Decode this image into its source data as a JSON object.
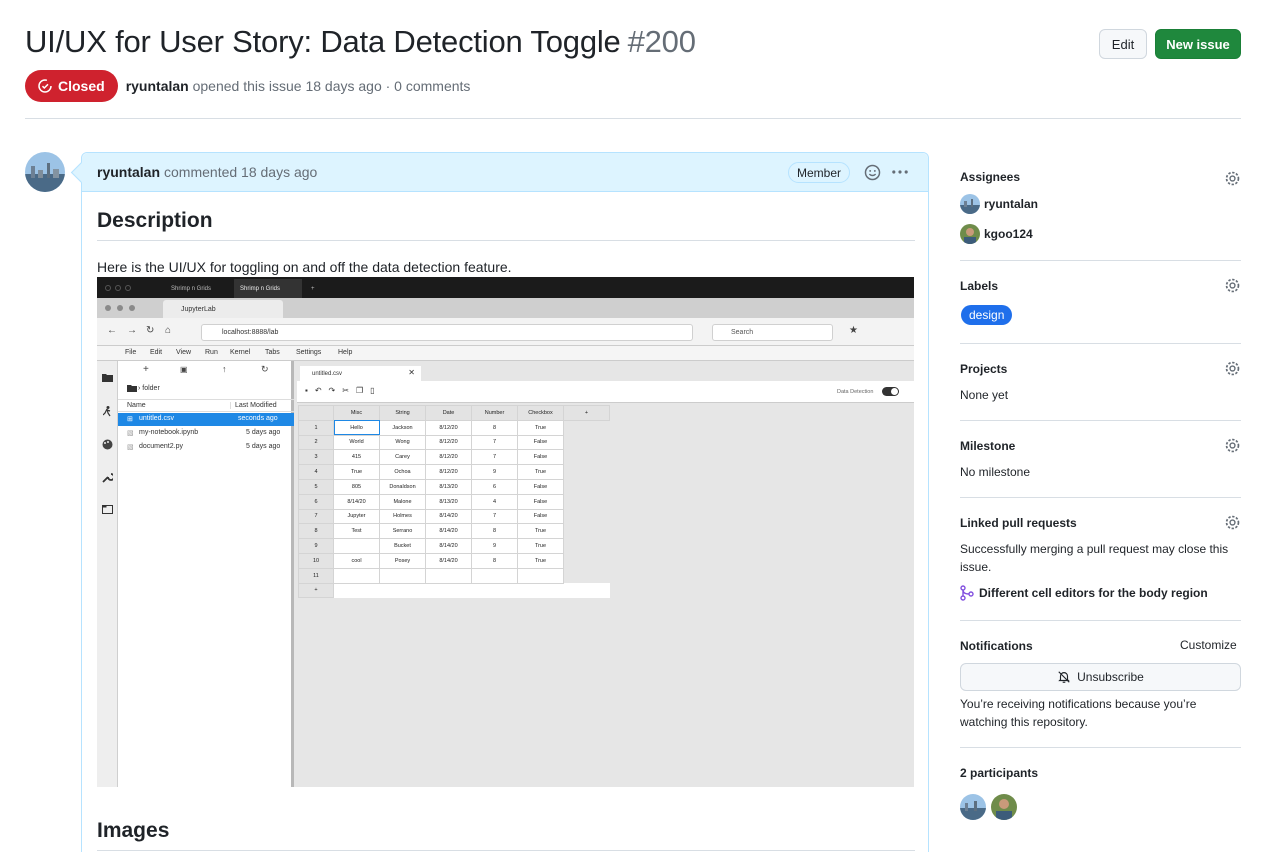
{
  "header": {
    "title": "UI/UX for User Story: Data Detection Toggle",
    "number": "#200",
    "edit_label": "Edit",
    "new_issue_label": "New issue",
    "state": "Closed",
    "author": "ryuntalan",
    "meta_text": "opened this issue 18 days ago · 0 comments"
  },
  "comment": {
    "author": "ryuntalan",
    "time": "commented 18 days ago",
    "role_badge": "Member",
    "heading_description": "Description",
    "body_text": "Here is the UI/UX for toggling on and off the data detection feature.",
    "heading_images": "Images"
  },
  "embedded_screenshot": {
    "browser_tabs": [
      "Shrimp n Grids",
      "Shrimp n Grids"
    ],
    "window_tab": "JupyterLab",
    "url": "localhost:8888/lab",
    "search_placeholder": "Search",
    "menu": [
      "File",
      "Edit",
      "View",
      "Run",
      "Kernel",
      "Tabs",
      "Settings",
      "Help"
    ],
    "breadcrumb": "› folder",
    "file_columns": [
      "Name",
      "Last Modified"
    ],
    "files": [
      {
        "name": "untitled.csv",
        "modified": "seconds ago"
      },
      {
        "name": "my-notebook.ipynb",
        "modified": "5 days ago"
      },
      {
        "name": "document2.py",
        "modified": "5 days ago"
      }
    ],
    "doc_tab": "untitled.csv",
    "data_detection_label": "Data Detection",
    "columns": [
      "Misc",
      "String",
      "Date",
      "Number",
      "Checkbox"
    ],
    "rows": [
      [
        "1",
        "Hello",
        "Jackson",
        "8/12/20",
        "8",
        "True"
      ],
      [
        "2",
        "World",
        "Wong",
        "8/12/20",
        "7",
        "False"
      ],
      [
        "3",
        "415",
        "Carey",
        "8/12/20",
        "7",
        "False"
      ],
      [
        "4",
        "True",
        "Ochoa",
        "8/12/20",
        "9",
        "True"
      ],
      [
        "5",
        "805",
        "Donaldson",
        "8/13/20",
        "6",
        "False"
      ],
      [
        "6",
        "8/14/20",
        "Malone",
        "8/13/20",
        "4",
        "False"
      ],
      [
        "7",
        "Jupyter",
        "Holmes",
        "8/14/20",
        "7",
        "False"
      ],
      [
        "8",
        "Test",
        "Serrano",
        "8/14/20",
        "8",
        "True"
      ],
      [
        "9",
        "",
        "Bucket",
        "8/14/20",
        "9",
        "True"
      ],
      [
        "10",
        "cool",
        "Posey",
        "8/14/20",
        "8",
        "True"
      ],
      [
        "11",
        "",
        "",
        "",
        "",
        ""
      ]
    ]
  },
  "sidebar": {
    "assignees_title": "Assignees",
    "assignees": [
      "ryuntalan",
      "kgoo124"
    ],
    "labels_title": "Labels",
    "label": "design",
    "projects_title": "Projects",
    "projects_value": "None yet",
    "milestone_title": "Milestone",
    "milestone_value": "No milestone",
    "linked_title": "Linked pull requests",
    "linked_desc": "Successfully merging a pull request may close this issue.",
    "linked_pr": "Different cell editors for the body region",
    "notifications_title": "Notifications",
    "customize": "Customize",
    "unsubscribe": "Unsubscribe",
    "notif_desc": "You’re receiving notifications because you’re watching this repository.",
    "participants_title": "2 participants"
  },
  "colors": {
    "closed": "#cf222e",
    "new_issue": "#1f883d",
    "label_design": "#1f6feb",
    "comment_header": "#ddf4ff"
  }
}
